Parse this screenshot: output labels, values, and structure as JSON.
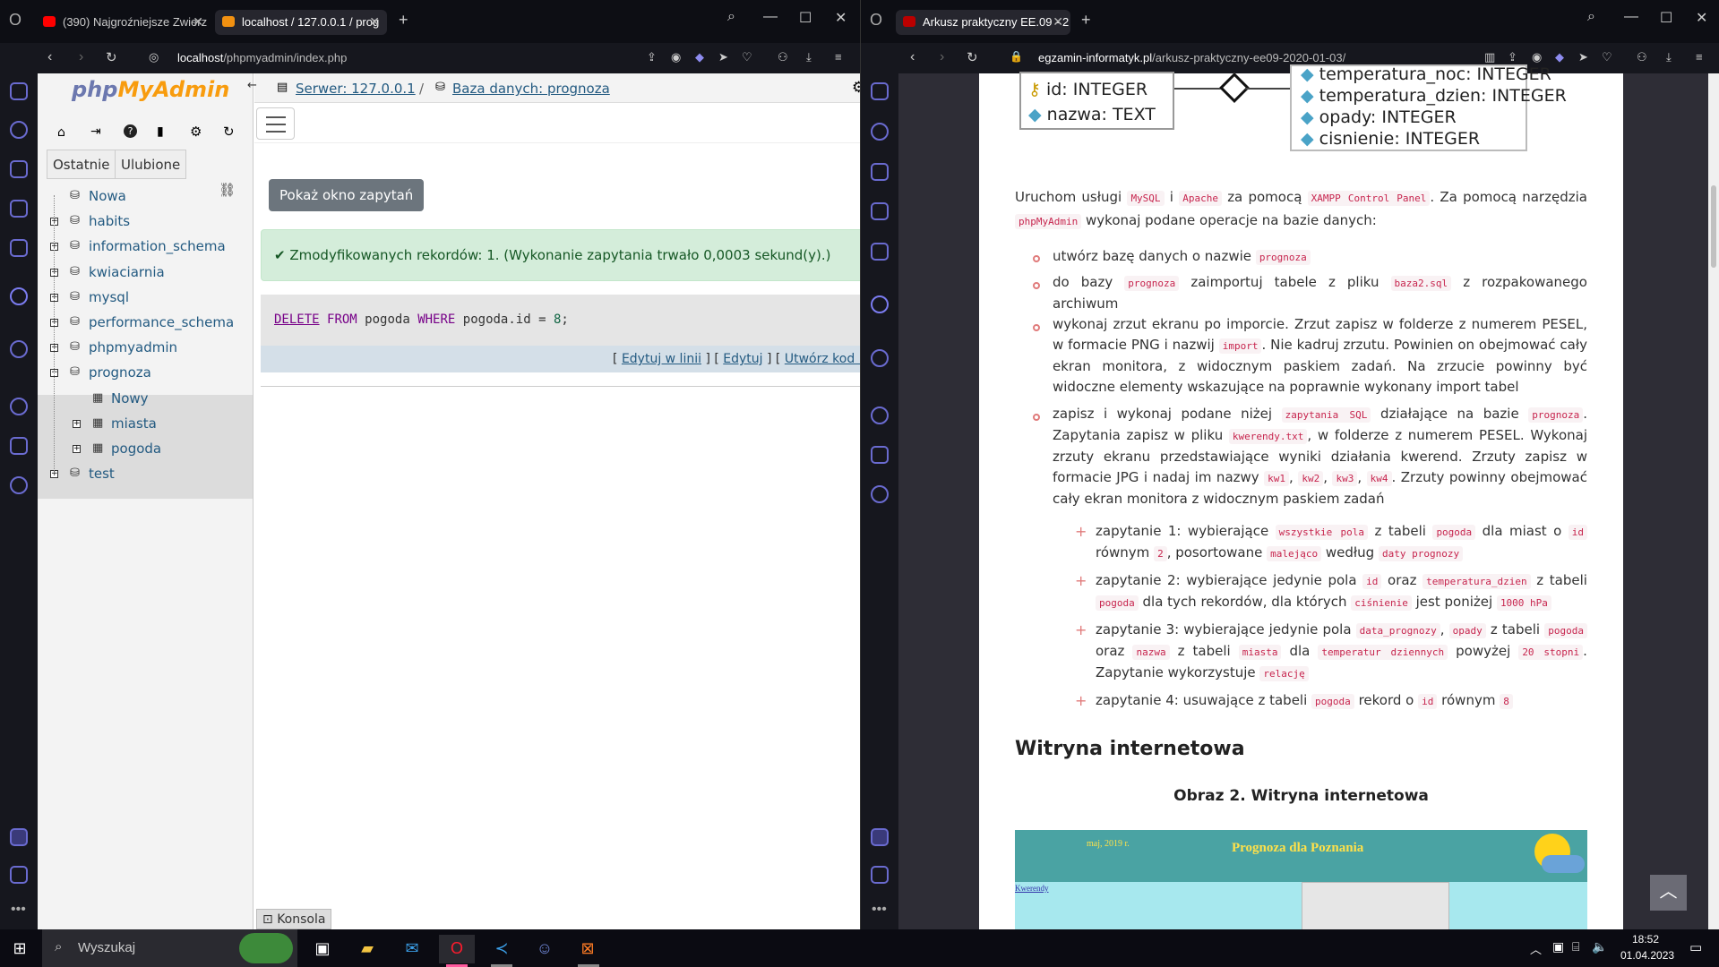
{
  "left_browser": {
    "tabs": [
      {
        "title": "(390) Najgroźniejsze Zwierz",
        "active": false
      },
      {
        "title": "localhost / 127.0.0.1 / prog",
        "active": true
      }
    ],
    "url_prefix": "localhost",
    "url_path": "/phpmyadmin/index.php"
  },
  "right_browser": {
    "tabs": [
      {
        "title": "Arkusz praktyczny EE.09 - 2",
        "active": true
      }
    ],
    "url_host": "egzamin-informatyk.pl",
    "url_path": "/arkusz-praktyczny-ee09-2020-01-03/"
  },
  "pma": {
    "logo_php": "php",
    "logo_myadmin": "MyAdmin",
    "recent_tab": "Ostatnie",
    "favorites_tab": "Ulubione",
    "breadcrumb_server": "Serwer: 127.0.0.1",
    "breadcrumb_db": "Baza danych: prognoza",
    "tree": [
      {
        "label": "Nowa",
        "level": 0,
        "type": "new"
      },
      {
        "label": "habits",
        "level": 0,
        "type": "db"
      },
      {
        "label": "information_schema",
        "level": 0,
        "type": "db"
      },
      {
        "label": "kwiaciarnia",
        "level": 0,
        "type": "db"
      },
      {
        "label": "mysql",
        "level": 0,
        "type": "db"
      },
      {
        "label": "performance_schema",
        "level": 0,
        "type": "db"
      },
      {
        "label": "phpmyadmin",
        "level": 0,
        "type": "db"
      },
      {
        "label": "prognoza",
        "level": 0,
        "type": "db-open"
      },
      {
        "label": "Nowy",
        "level": 1,
        "type": "new"
      },
      {
        "label": "miasta",
        "level": 1,
        "type": "table"
      },
      {
        "label": "pogoda",
        "level": 1,
        "type": "table"
      },
      {
        "label": "test",
        "level": 0,
        "type": "db"
      }
    ],
    "show_query_button": "Pokaż okno zapytań",
    "success_message": "Zmodyfikowanych rekordów: 1. (Wykonanie zapytania trwało 0,0003 sekund(y).)",
    "sql": {
      "kw_delete": "DELETE",
      "kw_from": "FROM",
      "table": "pogoda",
      "kw_where": "WHERE",
      "col": "pogoda",
      "col2": ".id",
      "op": " = ",
      "val": "8",
      "end": ";"
    },
    "link_edit_inline": "Edytuj w linii",
    "link_edit": "Edytuj",
    "link_php": "Utwórz kod PHP",
    "console_label": "Konsola"
  },
  "article": {
    "erd_left": [
      "id: INTEGER",
      "nazwa: TEXT"
    ],
    "erd_right": [
      "temperatura_noc: INTEGER",
      "temperatura_dzien: INTEGER",
      "opady: INTEGER",
      "cisnienie: INTEGER"
    ],
    "intro": {
      "t1": "Uruchom usługi",
      "c1": "MySQL",
      "t2": "i",
      "c2": "Apache",
      "t3": "za pomocą",
      "c3": "XAMPP Control Panel",
      "t4": ". Za pomocą narzędzia",
      "c4": "phpMyAdmin",
      "t5": "wykonaj podane operacje na bazie danych:"
    },
    "b1": {
      "t1": "utwórz bazę danych o nazwie",
      "c1": "prognoza"
    },
    "b2": {
      "t1": "do bazy",
      "c1": "prognoza",
      "t2": "zaimportuj tabele z pliku",
      "c2": "baza2.sql",
      "t3": "z rozpakowanego archiwum"
    },
    "b3": {
      "t1": "wykonaj zrzut ekranu po imporcie. Zrzut zapisz w folderze z numerem PESEL, w formacie PNG i nazwij",
      "c1": "import",
      "t2": ". Nie kadruj zrzutu. Powinien on obejmować cały ekran monitora, z widocznym paskiem zadań. Na zrzucie powinny być widoczne elementy wskazujące na poprawnie wykonany import tabel"
    },
    "b4": {
      "t1": "zapisz i wykonaj podane niżej",
      "c1": "zapytania SQL",
      "t2": "działające na bazie",
      "c2": "prognoza",
      "t3": ". Zapytania zapisz w pliku",
      "c3": "kwerendy.txt",
      "t4": ", w folderze z numerem PESEL. Wykonaj zrzuty ekranu przedstawiające wyniki działania kwerend. Zrzuty zapisz w formacie JPG i nadaj im nazwy",
      "c4": "kw1",
      "c5": "kw2",
      "c6": "kw3",
      "c7": "kw4",
      "t5": ". Zrzuty powinny obejmować cały ekran monitora z widocznym paskiem zadań"
    },
    "q1": {
      "t1": "zapytanie 1: wybierające",
      "c1": "wszystkie pola",
      "t2": "z tabeli",
      "c2": "pogoda",
      "t3": "dla miast o",
      "c3": "id",
      "t4": "równym",
      "c4": "2",
      "t5": ", posortowane",
      "c5": "malejąco",
      "t6": "według",
      "c6": "daty prognozy"
    },
    "q2": {
      "t1": "zapytanie 2: wybierające jedynie pola",
      "c1": "id",
      "t2": "oraz",
      "c2": "temperatura_dzien",
      "t3": "z tabeli",
      "c3": "pogoda",
      "t4": "dla tych rekordów, dla których",
      "c4": "ciśnienie",
      "t5": "jest poniżej",
      "c5": "1000 hPa"
    },
    "q3": {
      "t1": "zapytanie 3: wybierające jedynie pola",
      "c1": "data_prognozy",
      "c2": "opady",
      "t2": "z tabeli",
      "c3": "pogoda",
      "t3": "oraz",
      "c4": "nazwa",
      "t4": "z tabeli",
      "c5": "miasta",
      "t5": "dla",
      "c6": "temperatur dziennych",
      "t6": "powyżej",
      "c7": "20 stopni",
      "t7": ". Zapytanie wykorzystuje",
      "c8": "relację"
    },
    "q4": {
      "t1": "zapytanie 4: usuwające z tabeli",
      "c1": "pogoda",
      "t2": "rekord o",
      "c2": "id",
      "t3": "równym",
      "c3": "8"
    },
    "heading": "Witryna internetowa",
    "figure_caption": "Obraz 2. Witryna internetowa",
    "preview_date": "maj, 2019 r.",
    "preview_title": "Prognoza dla Poznania",
    "preview_link": "Kwerendy"
  },
  "taskbar": {
    "search_placeholder": "Wyszukaj",
    "time": "18:52",
    "date": "01.04.2023"
  }
}
